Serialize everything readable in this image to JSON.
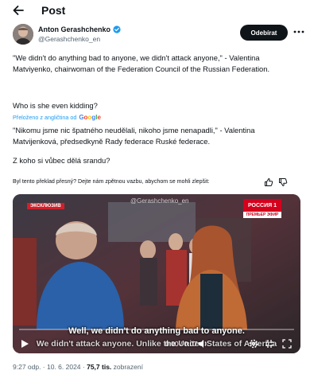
{
  "header": {
    "title": "Post"
  },
  "author": {
    "name": "Anton Gerashchenko",
    "handle": "@Gerashchenko_en",
    "follow_label": "Odebírat"
  },
  "tweet": {
    "text_original_1": "\"We didn't do anything bad to anyone, we didn't attack anyone,\" - Valentina Matviyenko, chairwoman of the Federation Council of the Russian Federation.",
    "text_original_2": "Who is she even kidding?",
    "translated_label": "Přeloženo z angličtina od",
    "translator_brand": "Google",
    "text_translated_1": "\"Nikomu jsme nic špatného neudělali, nikoho jsme nenapadli,\" - Valentina Matvijenková, předsedkyně Rady federace Ruské federace.",
    "text_translated_2": "Z koho si vůbec dělá srandu?"
  },
  "feedback": {
    "question": "Byl tento překlad přesný? Dejte nám zpětnou vazbu, abychom se mohli zlepšit:"
  },
  "video": {
    "watermark": "@Gerashchenko_en",
    "badge_left": "ЭКСКЛЮЗИВ",
    "channel_logo": "РОССИЯ 1",
    "channel_sub": "ПРЕМЬЕР ЭФИР",
    "subtitle_line1": "Well, we didn't do anything bad to anyone.",
    "subtitle_line2": "We didn't attack anyone. Unlike the United States of America",
    "time": "0:00 / 0:07",
    "progress": 0.0
  },
  "meta": {
    "time": "9:27 odp. · 10. 6. 2024 · ",
    "views_count": "75,7 tis.",
    "views_label": " zobrazení"
  },
  "colors": {
    "accent": "#1d9bf0",
    "text": "#0f1419",
    "secondary": "#536471",
    "follow_bg": "#0f1419"
  },
  "icons": [
    "arrow-left-icon",
    "verified-badge-icon",
    "more-icon",
    "thumbs-up-icon",
    "thumbs-down-icon",
    "play-icon",
    "volume-icon",
    "settings-icon",
    "exit-fullscreen-icon",
    "fullscreen-icon"
  ]
}
